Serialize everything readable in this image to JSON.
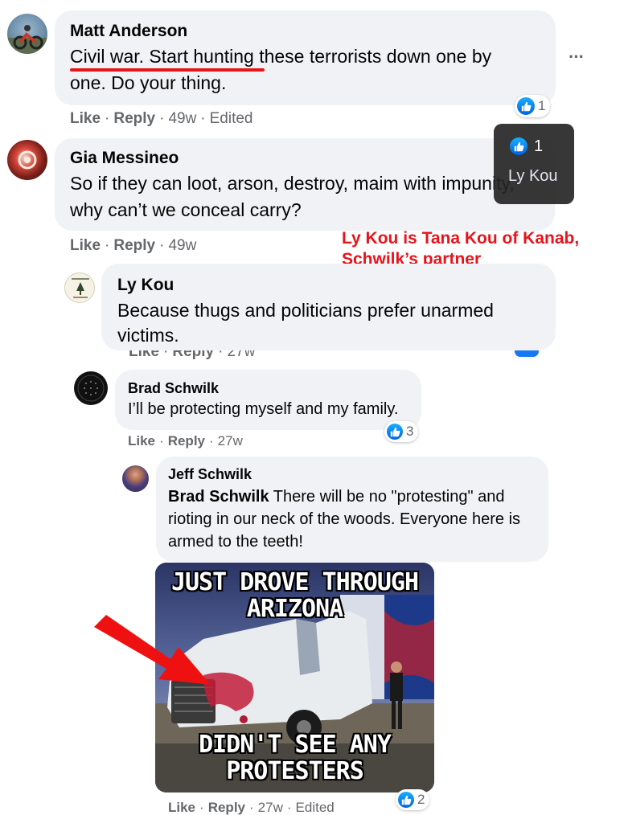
{
  "comments": [
    {
      "author": "Matt Anderson",
      "text_line1": "Civil war. Start hunting these terrorists down one by",
      "text_line2": "one. Do your thing.",
      "like": "Like",
      "reply": "Reply",
      "time": "49w",
      "edited": "Edited",
      "reactions": "1"
    },
    {
      "author": "Gia Messineo",
      "text_line1": "So if they can loot, arson, destroy, maim with impunity,",
      "text_line2": "why can’t we conceal carry?",
      "like": "Like",
      "reply": "Reply",
      "time": "49w"
    },
    {
      "author": "Ly Kou",
      "text_line1": "Because thugs and politicians prefer unarmed",
      "text_line2": "victims.",
      "like": "Like",
      "reply": "Reply",
      "time": "27w"
    },
    {
      "author": "Brad Schwilk",
      "text_line1": "I’ll be protecting myself and my family.",
      "like": "Like",
      "reply": "Reply",
      "time": "27w",
      "reactions": "3"
    },
    {
      "author": "Jeff Schwilk",
      "mention": "Brad Schwilk",
      "text_line1": " There will be no \"protesting\" and",
      "text_line2": "rioting in our neck of the woods. Everyone here is",
      "text_line3": "armed to the teeth!",
      "like": "Like",
      "reply": "Reply",
      "time": "27w",
      "edited": "Edited",
      "reactions": "2"
    }
  ],
  "tooltip": {
    "count": "1",
    "name": "Ly Kou"
  },
  "annotation": {
    "line1": "Ly Kou is Tana Kou of Kanab,",
    "line2": "Schwilk’s partner"
  },
  "meme": {
    "top_line1": "JUST DROVE THROUGH",
    "top_line2": "ARIZONA",
    "bottom_line1": "DIDN'T SEE ANY",
    "bottom_line2": "PROTESTERS"
  },
  "more_options": "···",
  "colors": {
    "bubble": "#f0f2f5",
    "meta": "#65676b",
    "annotation_red": "#e8141b",
    "like_blue": "#1877f2"
  }
}
